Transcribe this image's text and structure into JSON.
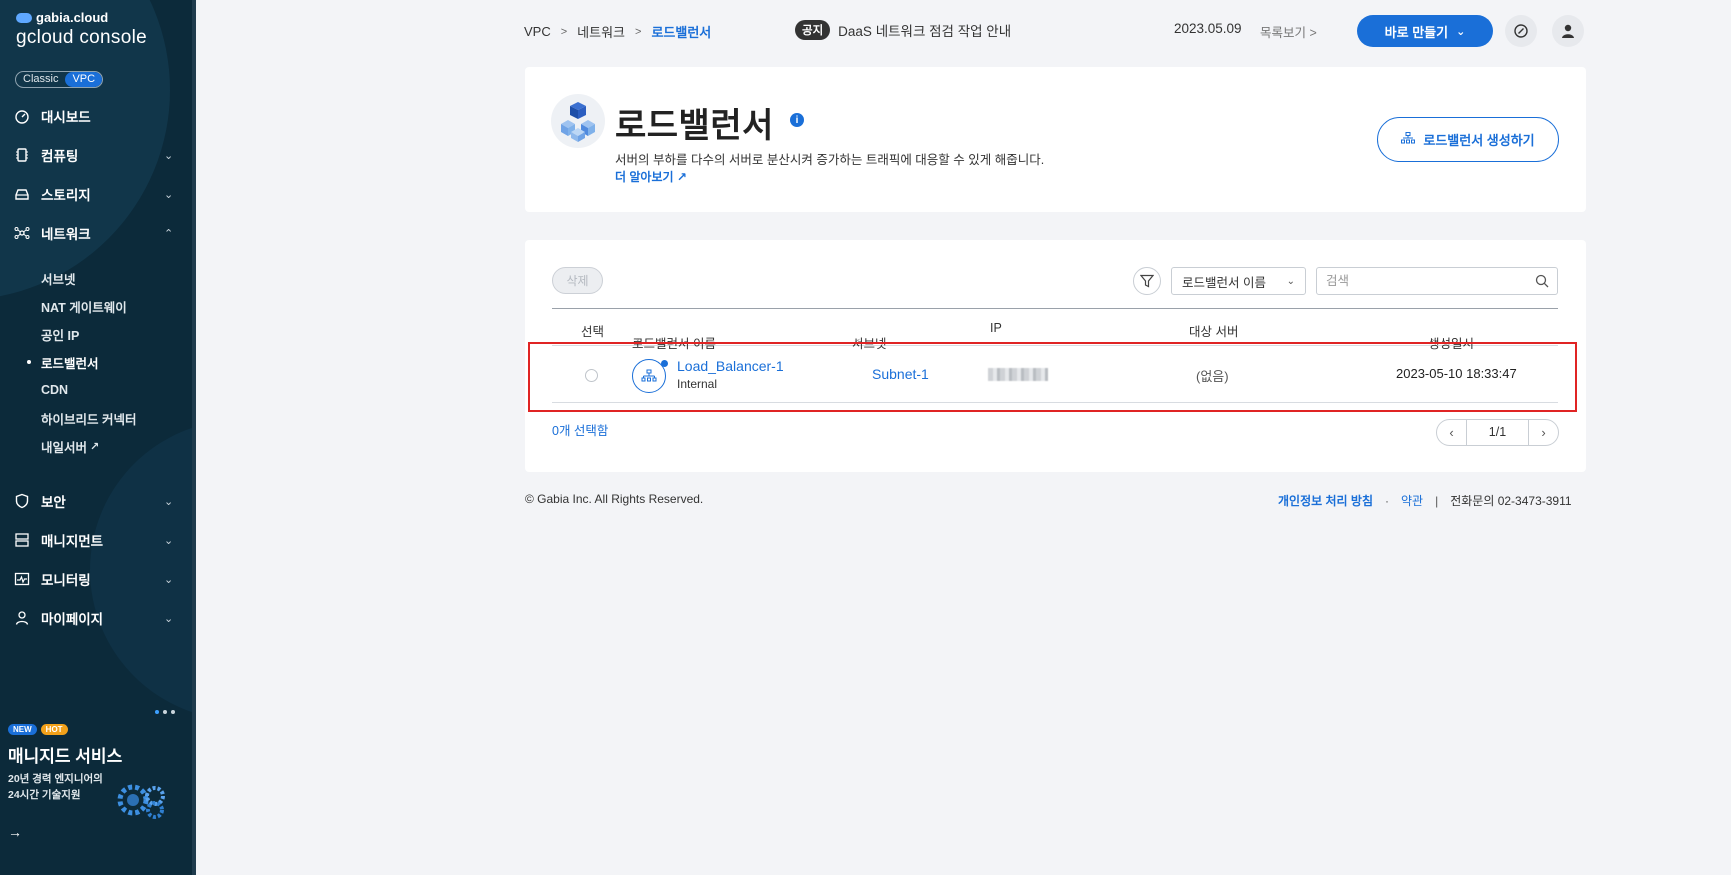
{
  "sidebar": {
    "brand": "gabia.cloud",
    "console": "gcloud console",
    "mode": {
      "classic": "Classic",
      "vpc": "VPC"
    },
    "items": [
      {
        "label": "대시보드"
      },
      {
        "label": "컴퓨팅"
      },
      {
        "label": "스토리지"
      },
      {
        "label": "네트워크"
      },
      {
        "label": "보안"
      },
      {
        "label": "매니지먼트"
      },
      {
        "label": "모니터링"
      },
      {
        "label": "마이페이지"
      }
    ],
    "network_sub": [
      {
        "label": "서브넷"
      },
      {
        "label": "NAT 게이트웨이"
      },
      {
        "label": "공인 IP"
      },
      {
        "label": "로드밸런서"
      },
      {
        "label": "CDN"
      },
      {
        "label": "하이브리드 커넥터"
      },
      {
        "label": "내일서버"
      }
    ],
    "promo": {
      "badge_new": "NEW",
      "badge_hot": "HOT",
      "title": "매니지드 서비스",
      "line1": "20년 경력 엔지니어의",
      "line2": "24시간 기술지원",
      "arrow": "→"
    }
  },
  "topbar": {
    "breadcrumb": [
      "VPC",
      "네트워크",
      "로드밸런서"
    ],
    "notice_tag": "공지",
    "notice_text": "DaaS 네트워크 점검 작업 안내",
    "notice_date": "2023.05.09",
    "notice_list": "목록보기",
    "quick_button": "바로 만들기"
  },
  "header": {
    "title": "로드밸런서",
    "description": "서버의 부하를 다수의 서버로 분산시켜 증가하는 트래픽에 대응할 수 있게 해줍니다.",
    "more_link": "더 알아보기",
    "create_button": "로드밸런서 생성하기"
  },
  "list": {
    "delete_button": "삭제",
    "filter_select": "로드밸런서 이름",
    "search_placeholder": "검색",
    "columns": {
      "select": "선택",
      "name": "로드밸런서 이름",
      "subnet": "서브넷",
      "ip": "IP",
      "target": "대상 서버",
      "created": "생성일시"
    },
    "rows": [
      {
        "name": "Load_Balancer-1",
        "type": "Internal",
        "subnet": "Subnet-1",
        "target": "(없음)",
        "created": "2023-05-10 18:33:47"
      }
    ],
    "selected_count": "0개 선택함",
    "pagination": "1/1"
  },
  "footer": {
    "copyright": "© Gabia Inc. All Rights Reserved.",
    "privacy": "개인정보 처리 방침",
    "dot": "·",
    "terms": "약관",
    "bar": "|",
    "phone": "전화문의  02-3473-3911"
  },
  "colors": {
    "sidebar_bg": "#0c2a3a",
    "accent": "#1a6fd8",
    "highlight": "#e02424"
  }
}
